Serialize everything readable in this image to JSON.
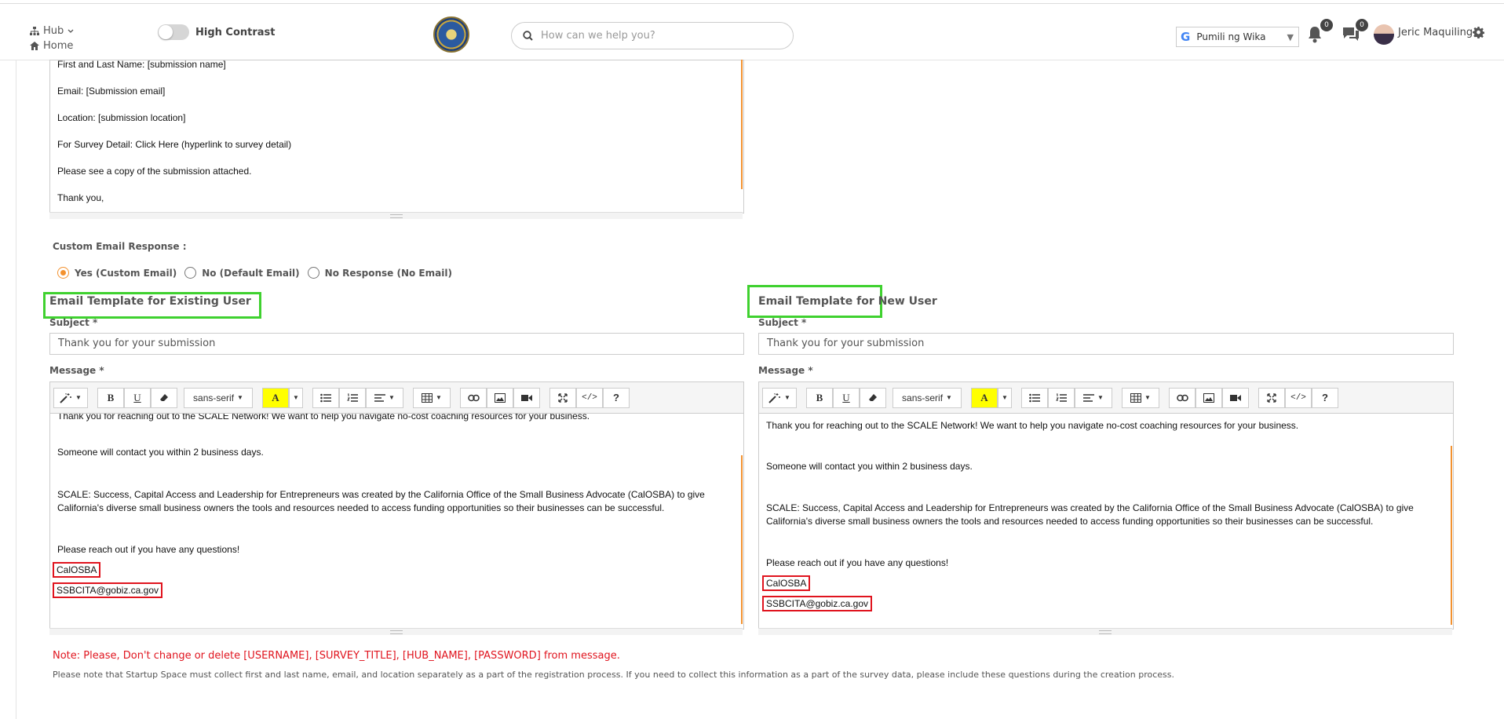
{
  "header": {
    "hub_label": "Hub",
    "home_label": "Home",
    "contrast_label": "High Contrast",
    "search_placeholder": "How can we help you?",
    "language_label": "Pumili ng Wika",
    "notifications_count": "0",
    "messages_count": "0",
    "user_name": "Jeric Maquiling"
  },
  "top_editor": {
    "lines": [
      "First and Last Name: [submission name]",
      "Email: [Submission email]",
      "Location: [submission location]",
      "For Survey Detail: Click Here (hyperlink to survey detail)",
      "Please see a copy of the submission attached.",
      "Thank you,"
    ]
  },
  "custom_response": {
    "label": "Custom Email Response :",
    "options": [
      "Yes (Custom Email)",
      "No (Default Email)",
      "No Response (No Email)"
    ],
    "selected": "Yes (Custom Email)"
  },
  "existing_user": {
    "title": "Email Template for Existing User",
    "subject_label": "Subject *",
    "subject_value": "Thank you for your submission",
    "message_label": "Message *",
    "lines": [
      "Thank you for reaching out to the SCALE Network! We want to help you navigate no-cost coaching resources for your business.",
      "Someone will contact you within 2 business days.",
      "SCALE: Success, Capital Access and Leadership for Entrepreneurs was created by the California Office of the Small Business Advocate (CalOSBA) to give",
      "California's diverse small business owners the tools and resources needed to access funding opportunities so their businesses can be successful.",
      "Please reach out if you have any questions!",
      "CalOSBA",
      "SSBCITA@gobiz.ca.gov"
    ]
  },
  "new_user": {
    "title": "Email Template for New User",
    "subject_label": "Subject *",
    "subject_value": "Thank you for your submission",
    "message_label": "Message *",
    "lines": [
      "Thank you for reaching out to the SCALE Network! We want to help you navigate no-cost coaching resources for your business.",
      "Someone will contact you within 2 business days.",
      "SCALE: Success, Capital Access and Leadership for Entrepreneurs was created by the California Office of the Small Business Advocate (CalOSBA) to give",
      "California's diverse small business owners the tools and resources needed to access funding opportunities so their businesses can be successful.",
      "Please reach out if you have any questions!",
      "CalOSBA",
      "SSBCITA@gobiz.ca.gov"
    ]
  },
  "toolbar": {
    "font_label": "sans-serif",
    "bold": "B",
    "underline": "U",
    "highlight": "A",
    "code": "</>",
    "help": "?"
  },
  "notes": {
    "warning": "Note: Please, Don't change or delete [USERNAME], [SURVEY_TITLE], [HUB_NAME], [PASSWORD] from message.",
    "info": "Please note that Startup Space must collect first and last name, email, and location separately as a part of the registration process. If you need to collect this information as a part of the survey data, please include these questions during the creation process."
  },
  "colors": {
    "accent_orange": "#f39230",
    "highlight_green": "#3fd12f",
    "highlight_red": "#e0141e"
  }
}
